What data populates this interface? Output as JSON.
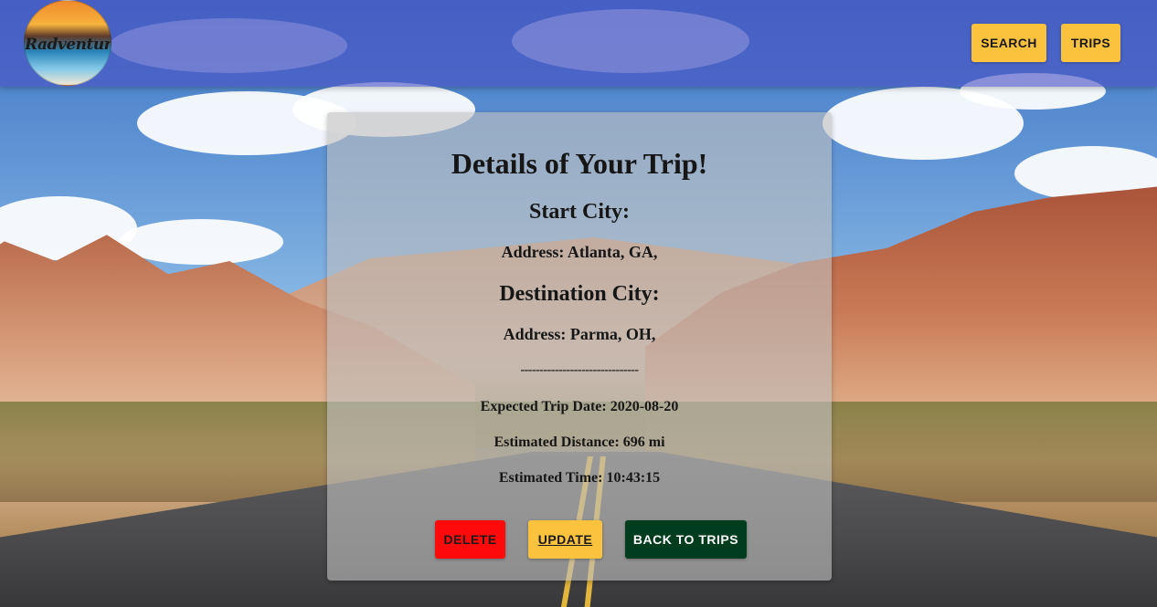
{
  "header": {
    "logo_text": "Radventure",
    "nav": [
      {
        "label": "SEARCH"
      },
      {
        "label": "TRIPS"
      }
    ]
  },
  "trip": {
    "heading": "Details of Your Trip!",
    "start_heading": "Start City:",
    "start_address": "Address: Atlanta, GA,",
    "destination_heading": "Destination City:",
    "destination_address": "Address: Parma, OH,",
    "divider": "-------------------------------",
    "trip_date": "Expected Trip Date: 2020-08-20",
    "distance": "Estimated Distance: 696 mi",
    "time": "Estimated Time: 10:43:15"
  },
  "actions": {
    "delete_label": "DELETE",
    "update_label": "UPDATE",
    "back_label": "BACK TO TRIPS"
  },
  "colors": {
    "header": "#4850c4",
    "accent_yellow": "#fbc23e",
    "delete_red": "#ff0a0a",
    "back_green": "#003d1f"
  }
}
